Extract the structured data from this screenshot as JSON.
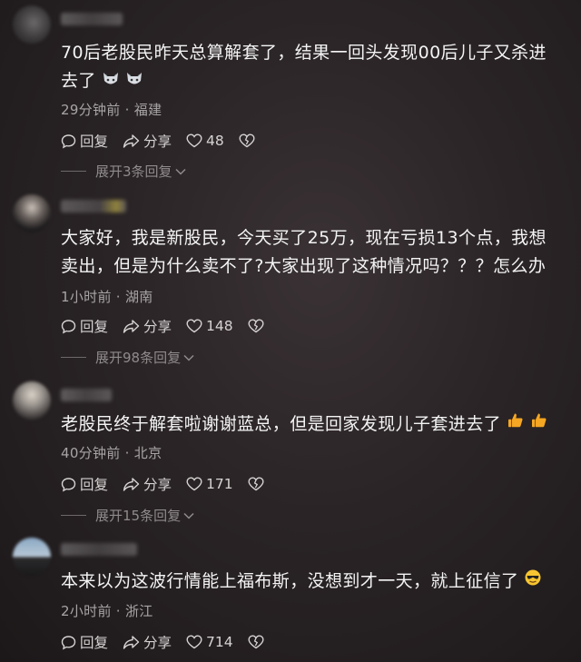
{
  "comments": [
    {
      "text_line1": "70后老股民昨天总算解套了，结果一回头发现00后儿子又杀进",
      "text_line2": "去了",
      "meta": "29分钟前 · 福建",
      "reply_label": "回复",
      "share_label": "分享",
      "likes": "48",
      "expand_label": "展开3条回复",
      "emoji": [
        "cat-face-icon",
        "cat-face-icon"
      ]
    },
    {
      "text_line1": "大家好，我是新股民，今天买了25万，现在亏损13个点，我想",
      "text_line2": "卖出，但是为什么卖不了?大家出现了这种情况吗？？？怎么办",
      "meta": "1小时前 · 湖南",
      "reply_label": "回复",
      "share_label": "分享",
      "likes": "148",
      "expand_label": "展开98条回复"
    },
    {
      "text_line1": "老股民终于解套啦谢谢蓝总，但是回家发现儿子套进去了",
      "meta": "40分钟前 · 北京",
      "reply_label": "回复",
      "share_label": "分享",
      "likes": "171",
      "expand_label": "展开15条回复",
      "emoji": [
        "thumbs-up-icon",
        "thumbs-up-icon"
      ]
    },
    {
      "text_line1": "本来以为这波行情能上福布斯，没想到才一天，就上征信了",
      "meta": "2小时前 · 浙江",
      "reply_label": "回复",
      "share_label": "分享",
      "likes": "714",
      "emoji": [
        "sunglasses-face-icon"
      ]
    }
  ],
  "colors": {
    "background": "#2a2426",
    "text": "#f4f4f4",
    "meta": "#a8a4a5",
    "thumbs": "#f5a623"
  }
}
